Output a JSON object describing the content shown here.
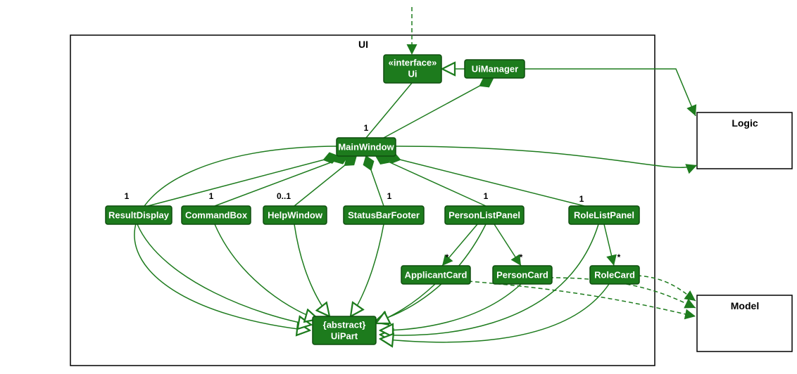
{
  "packages": {
    "ui": {
      "label": "UI"
    },
    "logic": {
      "label": "Logic"
    },
    "model": {
      "label": "Model"
    }
  },
  "nodes": {
    "ui_if": {
      "stereotype": "«interface»",
      "name": "Ui"
    },
    "uimgr": {
      "name": "UiManager"
    },
    "mainwin": {
      "name": "MainWindow"
    },
    "resultdisp": {
      "name": "ResultDisplay"
    },
    "cmdbox": {
      "name": "CommandBox"
    },
    "helpwin": {
      "name": "HelpWindow"
    },
    "statusbar": {
      "name": "StatusBarFooter"
    },
    "plp": {
      "name": "PersonListPanel"
    },
    "rlp": {
      "name": "RoleListPanel"
    },
    "appcard": {
      "name": "ApplicantCard"
    },
    "pcard": {
      "name": "PersonCard"
    },
    "rcard": {
      "name": "RoleCard"
    },
    "uipart": {
      "stereotype": "{abstract}",
      "name": "UiPart"
    }
  },
  "multiplicities": {
    "mainwin": "1",
    "resultdisp": "1",
    "cmdbox": "1",
    "helpwin": "0..1",
    "statusbar": "1",
    "plp": "1",
    "rlp": "1",
    "appcard": "*",
    "pcard": "*",
    "rcard": "*"
  },
  "chart_data": {
    "type": "uml-class-diagram",
    "packages": [
      "UI",
      "Logic",
      "Model"
    ],
    "classes": [
      {
        "name": "Ui",
        "stereotype": "interface",
        "package": "UI"
      },
      {
        "name": "UiManager",
        "package": "UI"
      },
      {
        "name": "MainWindow",
        "package": "UI"
      },
      {
        "name": "ResultDisplay",
        "package": "UI"
      },
      {
        "name": "CommandBox",
        "package": "UI"
      },
      {
        "name": "HelpWindow",
        "package": "UI"
      },
      {
        "name": "StatusBarFooter",
        "package": "UI"
      },
      {
        "name": "PersonListPanel",
        "package": "UI"
      },
      {
        "name": "RoleListPanel",
        "package": "UI"
      },
      {
        "name": "ApplicantCard",
        "package": "UI"
      },
      {
        "name": "PersonCard",
        "package": "UI"
      },
      {
        "name": "RoleCard",
        "package": "UI"
      },
      {
        "name": "UiPart",
        "stereotype": "abstract",
        "package": "UI"
      },
      {
        "name": "Logic",
        "package": "Logic"
      },
      {
        "name": "Model",
        "package": "Model"
      }
    ],
    "relationships": [
      {
        "from": "(external)",
        "to": "Ui",
        "type": "dependency"
      },
      {
        "from": "UiManager",
        "to": "Ui",
        "type": "realization"
      },
      {
        "from": "UiManager",
        "to": "MainWindow",
        "type": "composition",
        "mult": "1"
      },
      {
        "from": "MainWindow",
        "to": "ResultDisplay",
        "type": "composition",
        "mult": "1"
      },
      {
        "from": "MainWindow",
        "to": "CommandBox",
        "type": "composition",
        "mult": "1"
      },
      {
        "from": "MainWindow",
        "to": "HelpWindow",
        "type": "composition",
        "mult": "0..1"
      },
      {
        "from": "MainWindow",
        "to": "StatusBarFooter",
        "type": "composition",
        "mult": "1"
      },
      {
        "from": "MainWindow",
        "to": "PersonListPanel",
        "type": "composition",
        "mult": "1"
      },
      {
        "from": "MainWindow",
        "to": "RoleListPanel",
        "type": "composition",
        "mult": "1"
      },
      {
        "from": "PersonListPanel",
        "to": "ApplicantCard",
        "type": "association",
        "mult": "*"
      },
      {
        "from": "PersonListPanel",
        "to": "PersonCard",
        "type": "association",
        "mult": "*"
      },
      {
        "from": "RoleListPanel",
        "to": "RoleCard",
        "type": "association",
        "mult": "*"
      },
      {
        "from": "MainWindow",
        "to": "UiPart",
        "type": "generalization"
      },
      {
        "from": "ResultDisplay",
        "to": "UiPart",
        "type": "generalization"
      },
      {
        "from": "CommandBox",
        "to": "UiPart",
        "type": "generalization"
      },
      {
        "from": "HelpWindow",
        "to": "UiPart",
        "type": "generalization"
      },
      {
        "from": "StatusBarFooter",
        "to": "UiPart",
        "type": "generalization"
      },
      {
        "from": "PersonListPanel",
        "to": "UiPart",
        "type": "generalization"
      },
      {
        "from": "RoleListPanel",
        "to": "UiPart",
        "type": "generalization"
      },
      {
        "from": "ApplicantCard",
        "to": "UiPart",
        "type": "generalization"
      },
      {
        "from": "PersonCard",
        "to": "UiPart",
        "type": "generalization"
      },
      {
        "from": "RoleCard",
        "to": "UiPart",
        "type": "generalization"
      },
      {
        "from": "UiManager",
        "to": "Logic",
        "type": "association"
      },
      {
        "from": "MainWindow",
        "to": "Logic",
        "type": "association"
      },
      {
        "from": "PersonCard",
        "to": "Model",
        "type": "dependency"
      },
      {
        "from": "ApplicantCard",
        "to": "Model",
        "type": "dependency"
      },
      {
        "from": "RoleCard",
        "to": "Model",
        "type": "dependency"
      }
    ]
  }
}
